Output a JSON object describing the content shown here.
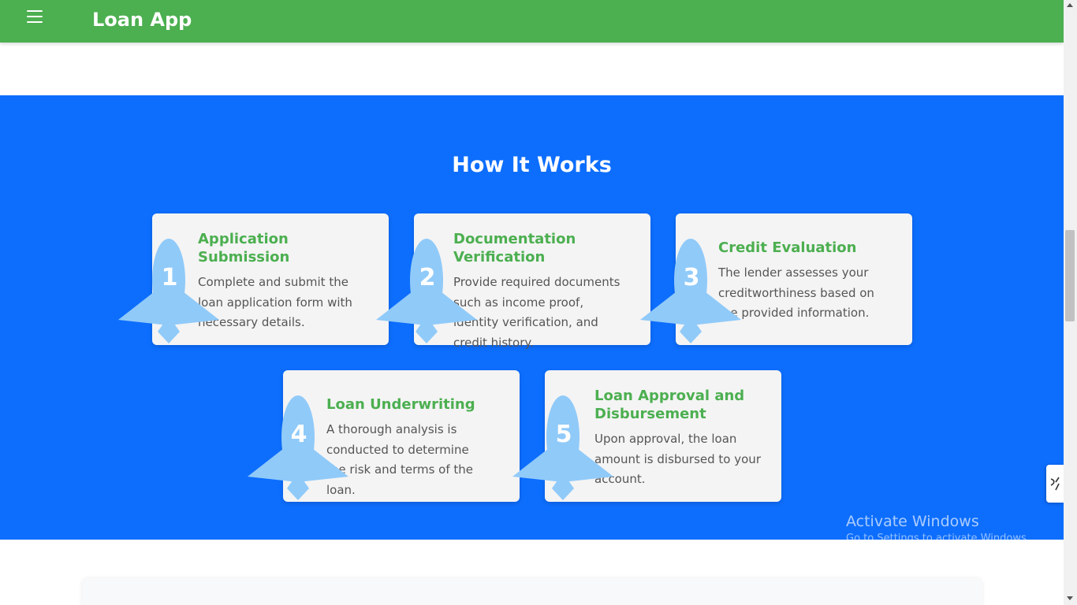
{
  "navbar": {
    "menu_icon": "hamburger-menu-icon",
    "brand": "Loan App",
    "background": "#4caf50"
  },
  "how_it_works": {
    "title": "How It Works",
    "background": "#0d6efd",
    "badge_color": "#90caf9",
    "title_color": "#4caf50",
    "steps": [
      {
        "number": "1",
        "title": "Application Submission",
        "description": "Complete and submit the loan application form with necessary details."
      },
      {
        "number": "2",
        "title": "Documentation Verification",
        "description": "Provide required documents such as income proof, identity verification, and credit history."
      },
      {
        "number": "3",
        "title": "Credit Evaluation",
        "description": "The lender assesses your creditworthiness based on the provided information."
      },
      {
        "number": "4",
        "title": "Loan Underwriting",
        "description": "A thorough analysis is conducted to determine the risk and terms of the loan."
      },
      {
        "number": "5",
        "title": "Loan Approval and Disbursement",
        "description": "Upon approval, the loan amount is disbursed to your account."
      }
    ]
  },
  "os_watermark": {
    "line1": "Activate Windows",
    "line2": "Go to Settings to activate Windows."
  }
}
